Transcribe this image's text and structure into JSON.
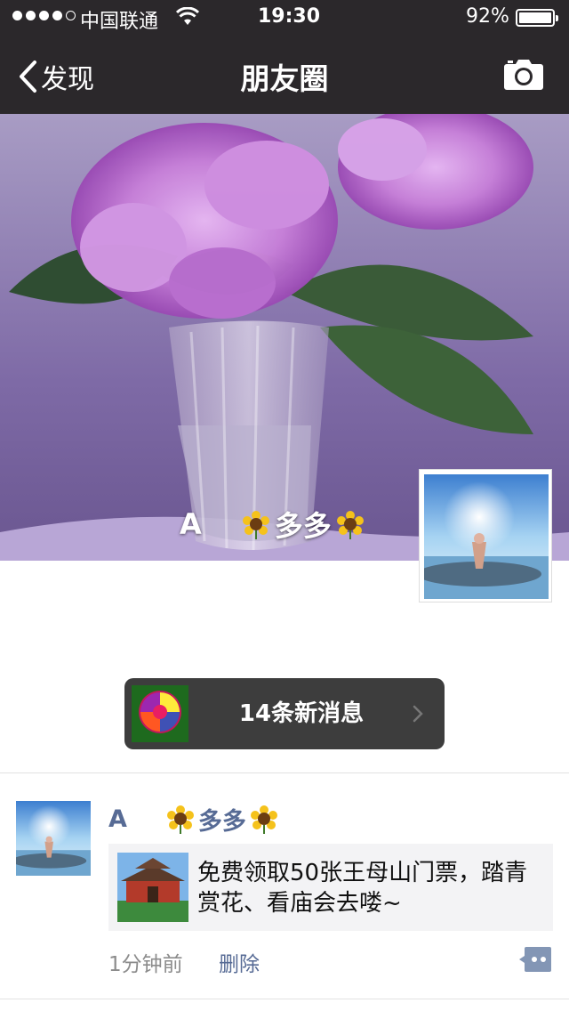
{
  "status": {
    "carrier": "中国联通",
    "time": "19:30",
    "battery_pct": "92%",
    "signal_bars": 4
  },
  "nav": {
    "back_label": "发现",
    "title": "朋友圈",
    "camera_icon": "camera-icon"
  },
  "cover": {
    "user_initial": "A",
    "user_nickname": "多多"
  },
  "notice": {
    "text": "14条新消息"
  },
  "post": {
    "author_initial": "A",
    "author_nickname": "多多",
    "link_text": "免费领取50张王母山门票，踏青赏花、看庙会去喽~",
    "time": "1分钟前",
    "delete_label": "删除"
  },
  "colors": {
    "bar_bg": "#2b282b",
    "link_blue": "#576b95",
    "notice_bg": "#3d3d3d"
  }
}
